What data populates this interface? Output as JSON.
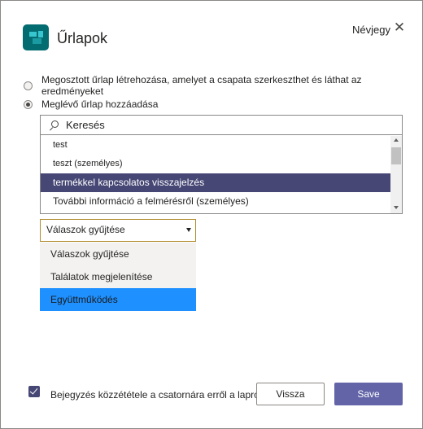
{
  "header": {
    "title": "Űrlapok",
    "card_link": "Névjegy",
    "close_glyph": "✕",
    "icon": "forms-app-icon"
  },
  "options": {
    "shared_form_label": "Megosztott űrlap létrehozása, amelyet a csapata szerkeszthet és láthat az eredményeket",
    "existing_form_label": "Meglévő űrlap hozzáadása",
    "selected": "existing"
  },
  "search": {
    "placeholder": "Keresés",
    "value": ""
  },
  "forms": [
    "test",
    "teszt (személyes)",
    "termékkel kapcsolatos visszajelzés",
    "További információ a felmérésről (személyes)"
  ],
  "selected_form": "termékkel kapcsolatos visszajelzés",
  "mode_select": {
    "value": "Válaszok gyűjtése",
    "options": [
      "Válaszok gyűjtése",
      "Találatok megjelenítése",
      "Együttműködés"
    ],
    "highlighted": "Együttműködés"
  },
  "footer": {
    "post_checkbox_label": "Bejegyzés közzététele a csatornára erről a lapról",
    "post_checked": true,
    "back_label": "Vissza",
    "save_label": "Save"
  },
  "colors": {
    "accent": "#6264a7",
    "selected_row": "#464775",
    "highlight_option": "#1e90ff",
    "app_icon": "#036c70"
  }
}
